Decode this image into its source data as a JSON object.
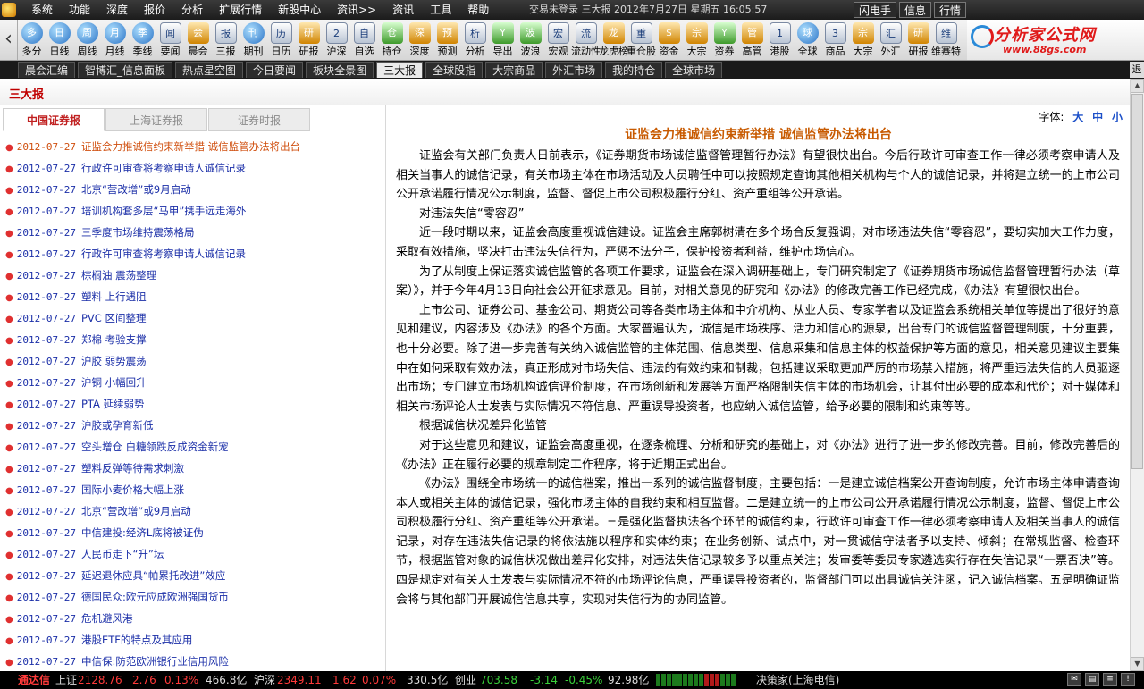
{
  "menubar": {
    "items": [
      "系统",
      "功能",
      "深度",
      "报价",
      "分析",
      "扩展行情",
      "新股中心",
      "资讯>>",
      "资讯",
      "工具",
      "帮助"
    ],
    "status": "交易未登录  三大报  2012年7月27日 星期五 16:05:57",
    "right_buttons": [
      "闪电手",
      "信息",
      "行情"
    ]
  },
  "toolbar": {
    "nav_left": "‹",
    "items": [
      {
        "label": "多分",
        "icon": "多",
        "style": ""
      },
      {
        "label": "日线",
        "icon": "日",
        "style": ""
      },
      {
        "label": "周线",
        "icon": "周",
        "style": ""
      },
      {
        "label": "月线",
        "icon": "月",
        "style": ""
      },
      {
        "label": "季线",
        "icon": "季",
        "style": ""
      },
      {
        "label": "要闻",
        "icon": "闻",
        "style": "sq"
      },
      {
        "label": "晨会",
        "icon": "会",
        "style": "or"
      },
      {
        "label": "三报",
        "icon": "报",
        "style": "sq"
      },
      {
        "label": "期刊",
        "icon": "刊",
        "style": ""
      },
      {
        "label": "日历",
        "icon": "历",
        "style": "sq"
      },
      {
        "label": "研报",
        "icon": "研",
        "style": "or"
      },
      {
        "label": "沪深",
        "icon": "2",
        "style": "sq"
      },
      {
        "label": "自选",
        "icon": "自",
        "style": "sq"
      },
      {
        "label": "持仓",
        "icon": "仓",
        "style": "gr"
      },
      {
        "label": "深度",
        "icon": "深",
        "style": "or"
      },
      {
        "label": "预测",
        "icon": "预",
        "style": "or"
      },
      {
        "label": "分析",
        "icon": "析",
        "style": "sq"
      },
      {
        "label": "导出",
        "icon": "Y",
        "style": "gr"
      },
      {
        "label": "波浪",
        "icon": "波",
        "style": "gr"
      },
      {
        "label": "宏观",
        "icon": "宏",
        "style": "sq"
      },
      {
        "label": "流动性",
        "icon": "流",
        "style": "sq"
      },
      {
        "label": "龙虎榜",
        "icon": "龙",
        "style": "or"
      },
      {
        "label": "重仓股",
        "icon": "重",
        "style": "sq"
      },
      {
        "label": "资金",
        "icon": "$",
        "style": "or"
      },
      {
        "label": "大宗",
        "icon": "宗",
        "style": "or"
      },
      {
        "label": "资券",
        "icon": "Y",
        "style": "gr"
      },
      {
        "label": "高管",
        "icon": "管",
        "style": "or"
      },
      {
        "label": "港股",
        "icon": "1",
        "style": "sq"
      },
      {
        "label": "全球",
        "icon": "球",
        "style": ""
      },
      {
        "label": "商品",
        "icon": "3",
        "style": "sq"
      },
      {
        "label": "大宗",
        "icon": "宗",
        "style": "or"
      },
      {
        "label": "外汇",
        "icon": "汇",
        "style": "sq"
      },
      {
        "label": "研报",
        "icon": "研",
        "style": "or"
      },
      {
        "label": "维赛特",
        "icon": "维",
        "style": "sq"
      }
    ],
    "brand_name": "分析家公式网",
    "brand_url": "www.88gs.com"
  },
  "tabstrip": {
    "tabs": [
      "晨会汇编",
      "智博汇_信息面板",
      "热点星空图",
      "今日要闻",
      "板块全景图",
      "三大报",
      "全球股指",
      "大宗商品",
      "外汇市场",
      "我的持仓",
      "全球市场"
    ],
    "active_index": 5,
    "back_label": "退"
  },
  "page": {
    "title": "三大报"
  },
  "sources": {
    "tabs": [
      "中国证券报",
      "上海证券报",
      "证券时报"
    ],
    "active_index": 0
  },
  "news": {
    "current_index": 0,
    "items": [
      {
        "date": "2012-07-27",
        "title": "证监会力推诚信约束新举措 诚信监管办法将出台"
      },
      {
        "date": "2012-07-27",
        "title": "行政许可审查将考察申请人诚信记录"
      },
      {
        "date": "2012-07-27",
        "title": "北京“营改增”或9月启动"
      },
      {
        "date": "2012-07-27",
        "title": "培训机构套多层“马甲”携手远走海外"
      },
      {
        "date": "2012-07-27",
        "title": "三季度市场维持震荡格局"
      },
      {
        "date": "2012-07-27",
        "title": "行政许可审查将考察申请人诚信记录"
      },
      {
        "date": "2012-07-27",
        "title": "棕榈油 震荡整理"
      },
      {
        "date": "2012-07-27",
        "title": "塑料 上行遇阻"
      },
      {
        "date": "2012-07-27",
        "title": "PVC 区间整理"
      },
      {
        "date": "2012-07-27",
        "title": "郑棉 考验支撑"
      },
      {
        "date": "2012-07-27",
        "title": "沪胶 弱势震荡"
      },
      {
        "date": "2012-07-27",
        "title": "沪铜 小幅回升"
      },
      {
        "date": "2012-07-27",
        "title": "PTA 延续弱势"
      },
      {
        "date": "2012-07-27",
        "title": "沪胶或孕育新低"
      },
      {
        "date": "2012-07-27",
        "title": "空头增仓 白糖领跌反成资金新宠"
      },
      {
        "date": "2012-07-27",
        "title": "塑料反弹等待需求刺激"
      },
      {
        "date": "2012-07-27",
        "title": "国际小麦价格大幅上涨"
      },
      {
        "date": "2012-07-27",
        "title": "北京“营改增”或9月启动"
      },
      {
        "date": "2012-07-27",
        "title": "中信建投:经济L底将被证伪"
      },
      {
        "date": "2012-07-27",
        "title": "人民币走下“升”坛"
      },
      {
        "date": "2012-07-27",
        "title": "延迟退休应具“帕累托改进”效应"
      },
      {
        "date": "2012-07-27",
        "title": "德国民众:欧元应成欧洲强国货币"
      },
      {
        "date": "2012-07-27",
        "title": "危机避风港"
      },
      {
        "date": "2012-07-27",
        "title": "港股ETF的特点及其应用"
      },
      {
        "date": "2012-07-27",
        "title": "中信保:防范欧洲银行业信用风险"
      }
    ]
  },
  "article": {
    "font_label": "字体:",
    "font_sizes": [
      "大",
      "中",
      "小"
    ],
    "headline": "证监会力推诚信约束新举措 诚信监管办法将出台",
    "paragraphs": [
      "证监会有关部门负责人日前表示，《证券期货市场诚信监督管理暂行办法》有望很快出台。今后行政许可审查工作一律必须考察申请人及相关当事人的诚信记录，有关市场主体在市场活动及人员聘任中可以按照规定查询其他相关机构与个人的诚信记录，并将建立统一的上市公司公开承诺履行情况公示制度，监督、督促上市公司积极履行分红、资产重组等公开承诺。",
      "对违法失信“零容忍”",
      "近一段时期以来，证监会高度重视诚信建设。证监会主席郭树清在多个场合反复强调，对市场违法失信“零容忍”，要切实加大工作力度，采取有效措施，坚决打击违法失信行为，严惩不法分子，保护投资者利益，维护市场信心。",
      "为了从制度上保证落实诚信监管的各项工作要求，证监会在深入调研基础上，专门研究制定了《证券期货市场诚信监督管理暂行办法（草案）》，并于今年4月13日向社会公开征求意见。目前，对相关意见的研究和《办法》的修改完善工作已经完成，《办法》有望很快出台。",
      "上市公司、证券公司、基金公司、期货公司等各类市场主体和中介机构、从业人员、专家学者以及证监会系统相关单位等提出了很好的意见和建议，内容涉及《办法》的各个方面。大家普遍认为，诚信是市场秩序、活力和信心的源泉，出台专门的诚信监督管理制度，十分重要，也十分必要。除了进一步完善有关纳入诚信监管的主体范围、信息类型、信息采集和信息主体的权益保护等方面的意见，相关意见建议主要集中在如何采取有效办法，真正形成对市场失信、违法的有效约束和制裁，包括建议采取更加严厉的市场禁入措施，将严重违法失信的人员驱逐出市场；专门建立市场机构诚信评价制度，在市场创新和发展等方面严格限制失信主体的市场机会，让其付出必要的成本和代价；对于媒体和相关市场评论人士发表与实际情况不符信息、严重误导投资者，也应纳入诚信监管，给予必要的限制和约束等等。",
      "根据诚信状况差异化监管",
      "对于这些意见和建议，证监会高度重视，在逐条梳理、分析和研究的基础上，对《办法》进行了进一步的修改完善。目前，修改完善后的《办法》正在履行必要的规章制定工作程序，将于近期正式出台。",
      "《办法》围绕全市场统一的诚信档案，推出一系列的诚信监督制度，主要包括：一是建立诚信档案公开查询制度，允许市场主体申请查询本人或相关主体的诚信记录，强化市场主体的自我约束和相互监督。二是建立统一的上市公司公开承诺履行情况公示制度，监督、督促上市公司积极履行分红、资产重组等公开承诺。三是强化监督执法各个环节的诚信约束，行政许可审查工作一律必须考察申请人及相关当事人的诚信记录，对存在违法失信记录的将依法施以程序和实体约束；在业务创新、试点中，对一贯诚信守法者予以支持、倾斜；在常规监督、检查环节，根据监管对象的诚信状况做出差异化安排，对违法失信记录较多予以重点关注；发审委等委员专家遴选实行存在失信记录“一票否决”等。四是规定对有关人士发表与实际情况不符的市场评论信息，严重误导投资者的，监督部门可以出具诚信关注函，记入诚信档案。五是明确证监会将与其他部门开展诚信信息共享，实现对失信行为的协同监管。"
    ]
  },
  "statusbar": {
    "brand": "通达信",
    "sh_label": "上证",
    "sh_index": "2128.76",
    "sh_change": "2.76",
    "sh_pct": "0.13%",
    "sh_amount": "466.8亿",
    "hs_label": "沪深",
    "hs_index": "2349.11",
    "hs_change": "1.62",
    "hs_pct": "0.07%",
    "hs_amount": "330.5亿",
    "cy_label": "创业",
    "cy_index": "703.58",
    "cy_change": "-3.14",
    "cy_pct": "-0.45%",
    "cy_amount": "92.98亿",
    "server": "决策家(上海电信)"
  },
  "colors": {
    "accent_red": "#c00000",
    "link_blue": "#1b2fa8",
    "headline_orange": "#c85a00",
    "up": "#ff3a3a",
    "down": "#3ad13a"
  }
}
